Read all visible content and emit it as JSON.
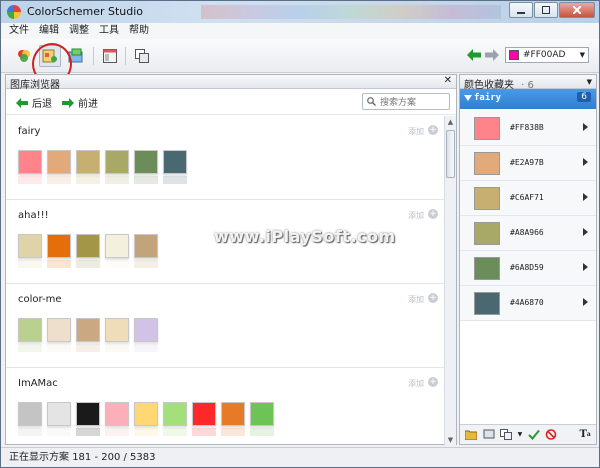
{
  "window": {
    "title": "ColorSchemer Studio"
  },
  "menu": [
    "文件",
    "编辑",
    "调整",
    "工具",
    "帮助"
  ],
  "toolbar": {
    "current_color": "#FF00AD",
    "current_color_hex": "#FF00AD"
  },
  "browser": {
    "title": "图库浏览器",
    "back": "后退",
    "forward": "前进",
    "search_placeholder": "搜索方案",
    "add_label": "添加",
    "schemes": [
      {
        "name": "fairy",
        "colors": [
          "#FF838B",
          "#E2A97B",
          "#C6AF71",
          "#A8A966",
          "#6A8D59",
          "#4A6870"
        ]
      },
      {
        "name": "aha!!!",
        "colors": [
          "#DED4A8",
          "#E36E0A",
          "#A39647",
          "#F3F0DE",
          "#C2A47A"
        ]
      },
      {
        "name": "color-me",
        "colors": [
          "#B9D08F",
          "#EEDFCD",
          "#C9A882",
          "#EEDDB8",
          "#D1C3E5"
        ]
      },
      {
        "name": "ImAMac",
        "colors": [
          "#C4C4C4",
          "#E4E4E4",
          "#1A1A1A",
          "#FBAFB8",
          "#FFD873",
          "#A4E07A",
          "#FF2828",
          "#E57A28",
          "#6EC356"
        ]
      }
    ]
  },
  "favorites": {
    "title": "颜色收藏夹",
    "count": "6",
    "folder": "fairy",
    "folder_count": "6",
    "items": [
      {
        "hex": "#FF838B",
        "color": "#FF838B"
      },
      {
        "hex": "#E2A97B",
        "color": "#E2A97B"
      },
      {
        "hex": "#C6AF71",
        "color": "#C6AF71"
      },
      {
        "hex": "#A8A966",
        "color": "#A8A966"
      },
      {
        "hex": "#6A8D59",
        "color": "#6A8D59"
      },
      {
        "hex": "#4A6870",
        "color": "#4A6870"
      }
    ]
  },
  "status": {
    "label": "正在显示方案",
    "range": "181 - 200 / 5383"
  },
  "watermark": "www.iPlaySoft.com"
}
